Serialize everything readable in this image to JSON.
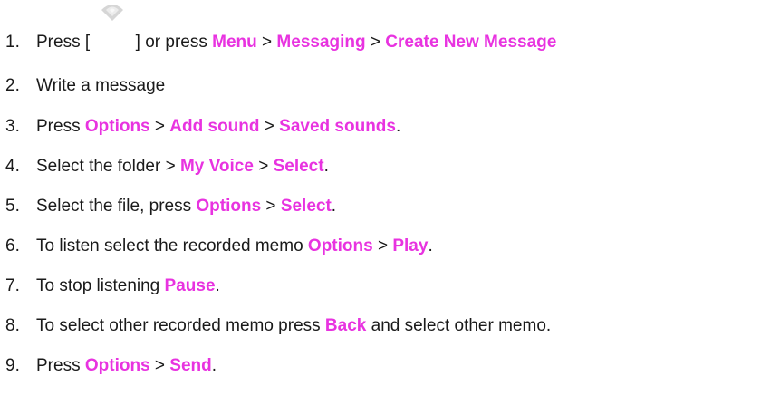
{
  "steps": [
    {
      "number": "1.",
      "parts": [
        {
          "t": "Press [ ",
          "k": false
        },
        {
          "icon": "softkey-icon"
        },
        {
          "t": " ] or press ",
          "k": false
        },
        {
          "t": "Menu",
          "k": true
        },
        {
          "t": " > ",
          "k": false
        },
        {
          "t": "Messaging",
          "k": true
        },
        {
          "t": " > ",
          "k": false
        },
        {
          "t": "Create New Message",
          "k": true
        }
      ]
    },
    {
      "number": "2.",
      "parts": [
        {
          "t": "Write a message",
          "k": false
        }
      ]
    },
    {
      "number": "3.",
      "parts": [
        {
          "t": "Press ",
          "k": false
        },
        {
          "t": "Options",
          "k": true
        },
        {
          "t": " > ",
          "k": false
        },
        {
          "t": "Add sound",
          "k": true
        },
        {
          "t": " > ",
          "k": false
        },
        {
          "t": "Saved sounds",
          "k": true
        },
        {
          "t": ".",
          "k": false
        }
      ]
    },
    {
      "number": "4.",
      "parts": [
        {
          "t": "Select the folder > ",
          "k": false
        },
        {
          "t": "My Voice",
          "k": true
        },
        {
          "t": " > ",
          "k": false
        },
        {
          "t": "Select",
          "k": true
        },
        {
          "t": ".",
          "k": false
        }
      ]
    },
    {
      "number": "5.",
      "parts": [
        {
          "t": "Select the file, press ",
          "k": false
        },
        {
          "t": "Options",
          "k": true
        },
        {
          "t": " > ",
          "k": false
        },
        {
          "t": "Select",
          "k": true
        },
        {
          "t": ".",
          "k": false
        }
      ]
    },
    {
      "number": "6.",
      "parts": [
        {
          "t": "To listen select the recorded memo ",
          "k": false
        },
        {
          "t": "Options",
          "k": true
        },
        {
          "t": " > ",
          "k": false
        },
        {
          "t": "Play",
          "k": true
        },
        {
          "t": ".",
          "k": false
        }
      ]
    },
    {
      "number": "7.",
      "parts": [
        {
          "t": "To stop listening ",
          "k": false
        },
        {
          "t": "Pause",
          "k": true
        },
        {
          "t": ".",
          "k": false
        }
      ]
    },
    {
      "number": "8.",
      "parts": [
        {
          "t": "To select other recorded memo press ",
          "k": false
        },
        {
          "t": "Back",
          "k": true
        },
        {
          "t": " and select other memo.",
          "k": false
        }
      ]
    },
    {
      "number": "9.",
      "parts": [
        {
          "t": "Press ",
          "k": false
        },
        {
          "t": "Options",
          "k": true
        },
        {
          "t": " > ",
          "k": false
        },
        {
          "t": "Send",
          "k": true
        },
        {
          "t": ".",
          "k": false
        }
      ]
    }
  ],
  "colors": {
    "keyword": "#e833e0",
    "text": "#1a1a1a"
  }
}
